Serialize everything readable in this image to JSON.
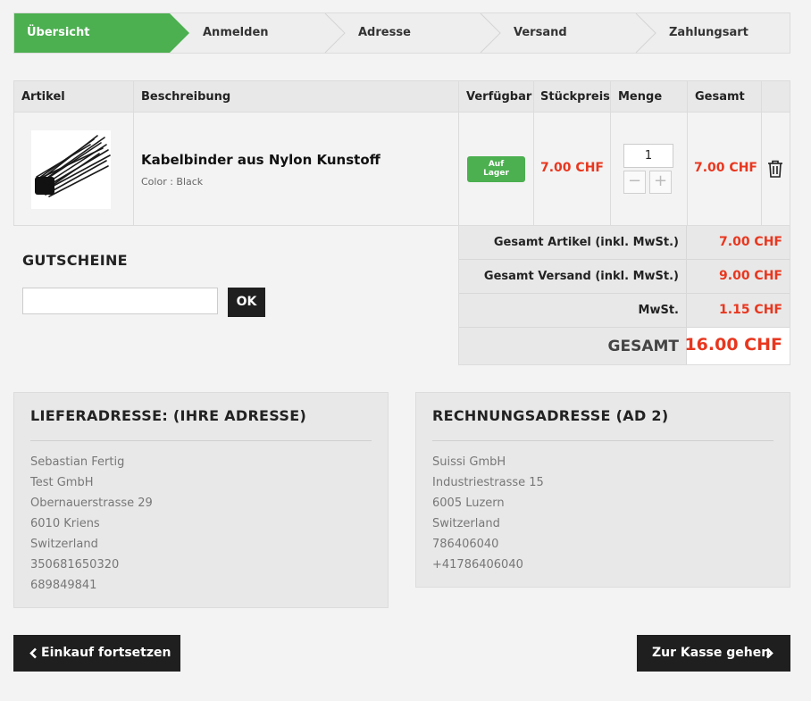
{
  "steps": [
    {
      "label": "Übersicht",
      "active": true
    },
    {
      "label": "Anmelden",
      "active": false
    },
    {
      "label": "Adresse",
      "active": false
    },
    {
      "label": "Versand",
      "active": false
    },
    {
      "label": "Zahlungsart",
      "active": false
    }
  ],
  "cart": {
    "headers": {
      "article": "Artikel",
      "description": "Beschreibung",
      "available": "Verfügbar",
      "unit_price": "Stückpreis",
      "quantity": "Menge",
      "total": "Gesamt"
    },
    "item": {
      "image_icon": "cable-ties-image",
      "name": "Kabelbinder aus Nylon Kunstoff",
      "option": "Color : Black",
      "stock": "Auf\nLager",
      "unit_price": "7.00 CHF",
      "quantity": "1",
      "total": "7.00 CHF"
    }
  },
  "coupon": {
    "title": "GUTSCHEINE",
    "placeholder": "",
    "button": "OK"
  },
  "totals": {
    "articles_label": "Gesamt Artikel (inkl. MwSt.)",
    "articles_value": "7.00 CHF",
    "shipping_label": "Gesamt Versand (inkl. MwSt.)",
    "shipping_value": "9.00 CHF",
    "vat_label": "MwSt.",
    "vat_value": "1.15 CHF",
    "grand_label": "GESAMT",
    "grand_value": "16.00 CHF"
  },
  "delivery_address": {
    "title": "LIEFERADRESSE: (IHRE ADRESSE)",
    "lines": [
      "Sebastian Fertig",
      "Test GmbH",
      "Obernauerstrasse 29",
      "6010 Kriens",
      "Switzerland",
      "350681650320",
      "689849841"
    ]
  },
  "billing_address": {
    "title": "RECHNUNGSADRESSE (AD 2)",
    "lines": [
      "Suissi GmbH",
      "Industriestrasse 15",
      "6005 Luzern",
      "Switzerland",
      "786406040",
      "+41786406040"
    ]
  },
  "buttons": {
    "continue_shopping": "Einkauf fortsetzen",
    "checkout": "Zur Kasse gehen"
  },
  "colors": {
    "accent_green": "#4caf50",
    "price_red": "#e8371f",
    "dark_button": "#1f1f1f"
  }
}
